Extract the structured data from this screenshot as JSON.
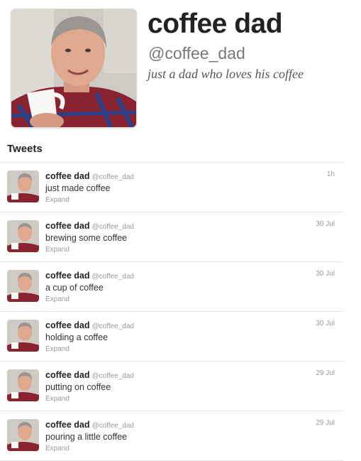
{
  "profile": {
    "name": "coffee dad",
    "handle": "@coffee_dad",
    "bio": "just a dad who loves his coffee"
  },
  "tweets_header": "Tweets",
  "tweets": [
    {
      "name": "coffee dad",
      "handle": "@coffee_dad",
      "time": "1h",
      "text": "just made coffee",
      "expand": "Expand"
    },
    {
      "name": "coffee dad",
      "handle": "@coffee_dad",
      "time": "30 Jul",
      "text": "brewing some coffee",
      "expand": "Expand"
    },
    {
      "name": "coffee dad",
      "handle": "@coffee_dad",
      "time": "30 Jul",
      "text": "a cup of coffee",
      "expand": "Expand"
    },
    {
      "name": "coffee dad",
      "handle": "@coffee_dad",
      "time": "30 Jul",
      "text": "holding a coffee",
      "expand": "Expand"
    },
    {
      "name": "coffee dad",
      "handle": "@coffee_dad",
      "time": "29 Jul",
      "text": "putting on coffee",
      "expand": "Expand"
    },
    {
      "name": "coffee dad",
      "handle": "@coffee_dad",
      "time": "29 Jul",
      "text": "pouring a little coffee",
      "expand": "Expand"
    }
  ],
  "colors": {
    "name": "#222222",
    "meta": "#999999",
    "divider": "#e3e3e3"
  }
}
